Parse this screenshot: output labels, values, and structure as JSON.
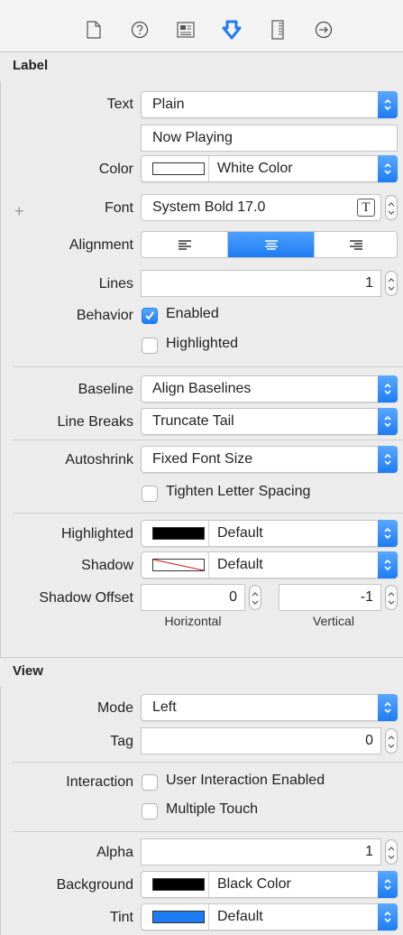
{
  "tabs": [
    {
      "name": "file-inspector-icon"
    },
    {
      "name": "quick-help-icon"
    },
    {
      "name": "identity-inspector-icon"
    },
    {
      "name": "attributes-inspector-icon",
      "active": true
    },
    {
      "name": "size-inspector-icon"
    },
    {
      "name": "connections-inspector-icon"
    }
  ],
  "label_section": {
    "header": "Label",
    "text": {
      "label": "Text",
      "value": "Plain"
    },
    "text_value": "Now Playing",
    "color": {
      "label": "Color",
      "value": "White Color",
      "swatch": "#ffffff"
    },
    "font": {
      "label": "Font",
      "value": "System Bold 17.0",
      "add": "+",
      "button": "T"
    },
    "alignment": {
      "label": "Alignment",
      "selected": "center"
    },
    "lines": {
      "label": "Lines",
      "value": "1"
    },
    "behavior": {
      "label": "Behavior",
      "enabled": "Enabled",
      "highlighted": "Highlighted"
    },
    "baseline": {
      "label": "Baseline",
      "value": "Align Baselines"
    },
    "line_breaks": {
      "label": "Line Breaks",
      "value": "Truncate Tail"
    },
    "autoshrink": {
      "label": "Autoshrink",
      "value": "Fixed Font Size"
    },
    "tighten": "Tighten Letter Spacing",
    "highlighted": {
      "label": "Highlighted",
      "value": "Default",
      "swatch": "#000000"
    },
    "shadow": {
      "label": "Shadow",
      "value": "Default"
    },
    "shadow_offset": {
      "label": "Shadow Offset",
      "horizontal": "0",
      "vertical": "-1",
      "h_label": "Horizontal",
      "v_label": "Vertical"
    }
  },
  "view_section": {
    "header": "View",
    "mode": {
      "label": "Mode",
      "value": "Left"
    },
    "tag": {
      "label": "Tag",
      "value": "0"
    },
    "interaction": {
      "label": "Interaction",
      "user": "User Interaction Enabled",
      "multi": "Multiple Touch"
    },
    "alpha": {
      "label": "Alpha",
      "value": "1"
    },
    "background": {
      "label": "Background",
      "value": "Black Color",
      "swatch": "#000000"
    },
    "tint": {
      "label": "Tint",
      "value": "Default",
      "swatch": "#1e7cf2"
    }
  },
  "colors": {
    "accent": "#1e7cf2"
  }
}
